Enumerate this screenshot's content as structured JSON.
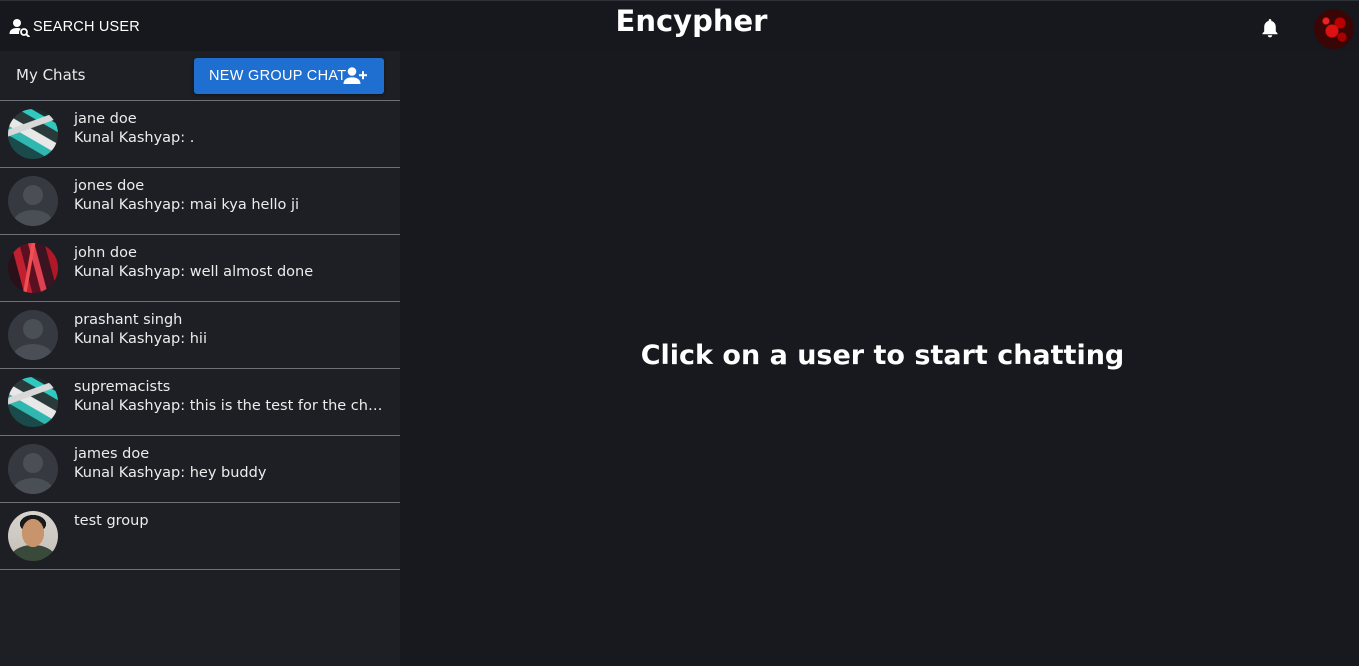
{
  "topbar": {
    "search_label": "SEARCH USER",
    "brand": "Encypher",
    "search_icon": "person-search-icon",
    "bell_icon": "bell-icon",
    "avatar": "user-avatar"
  },
  "sidebar": {
    "header_title": "My Chats",
    "new_group_label": "NEW GROUP CHAT",
    "new_group_icon": "person-add-icon",
    "chats": [
      {
        "name": "jane doe",
        "message": "Kunal Kashyap: .",
        "avatar": "teal-art"
      },
      {
        "name": "jones doe",
        "message": "Kunal Kashyap: mai kya hello ji",
        "avatar": "default"
      },
      {
        "name": "john doe",
        "message": "Kunal Kashyap: well almost done",
        "avatar": "red-art"
      },
      {
        "name": "prashant singh",
        "message": "Kunal Kashyap: hii",
        "avatar": "default"
      },
      {
        "name": "supremacists",
        "message": "Kunal Kashyap: this is the test for the chat ...",
        "avatar": "teal-art"
      },
      {
        "name": "james doe",
        "message": "Kunal Kashyap: hey buddy",
        "avatar": "default"
      },
      {
        "name": "test group",
        "message": "",
        "avatar": "photo"
      }
    ]
  },
  "main": {
    "placeholder": "Click on a user to start chatting"
  },
  "colors": {
    "accent": "#1f6fd1",
    "background": "#18191e",
    "sidebar": "#1d1f25"
  }
}
